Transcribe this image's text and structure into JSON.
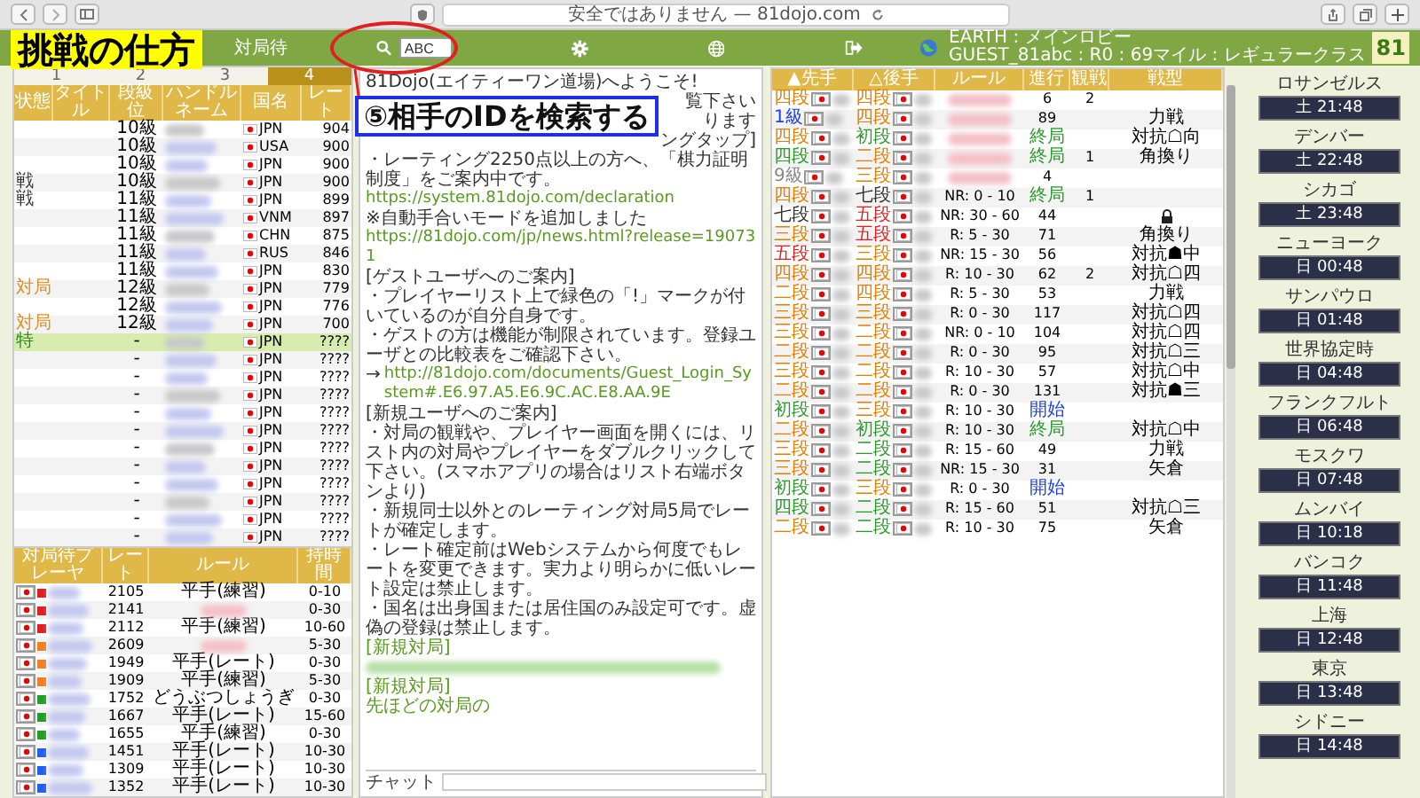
{
  "browser": {
    "address": "安全ではありません — 81dojo.com"
  },
  "overlay": {
    "label": "挑戦の仕方",
    "callout": "⑤相手のIDを検索する"
  },
  "toolbar": {
    "waiting_label": "対局待",
    "search_value": "ABC",
    "lobby_line": "EARTH : メインロビー",
    "user_line": "GUEST_81abc : R0 : 69マイル : レギュラークラス",
    "logo": "81"
  },
  "player_tabs": [
    {
      "label": "1",
      "selected": false
    },
    {
      "label": "2",
      "selected": false
    },
    {
      "label": "3",
      "selected": false
    },
    {
      "label": "4",
      "selected": true
    }
  ],
  "players": {
    "columns": [
      "状態",
      "タイトル",
      "段級位",
      "ハンドルネーム",
      "国名",
      "レート"
    ],
    "rows": [
      {
        "rank": "10級",
        "country": "JPN",
        "rate": "904",
        "selected": false
      },
      {
        "rank": "10級",
        "country": "USA",
        "rate": "900",
        "selected": false
      },
      {
        "rank": "10級",
        "country": "JPN",
        "rate": "900",
        "selected": false
      },
      {
        "status": "戦",
        "color": "#333333",
        "rank": "10級",
        "country": "JPN",
        "rate": "900",
        "selected": false
      },
      {
        "status": "戦",
        "color": "#333333",
        "rank": "11級",
        "country": "JPN",
        "rate": "899",
        "selected": false
      },
      {
        "rank": "11級",
        "country": "VNM",
        "rate": "897",
        "selected": false
      },
      {
        "rank": "11級",
        "country": "CHN",
        "rate": "875",
        "selected": false
      },
      {
        "rank": "11級",
        "country": "RUS",
        "rate": "846",
        "selected": false
      },
      {
        "rank": "11級",
        "country": "JPN",
        "rate": "830",
        "selected": false
      },
      {
        "status": "対局",
        "color": "#e09020",
        "rank": "12級",
        "country": "JPN",
        "rate": "779",
        "selected": false
      },
      {
        "rank": "12級",
        "country": "JPN",
        "rate": "776",
        "selected": false
      },
      {
        "status": "対局",
        "color": "#e09020",
        "rank": "12級",
        "country": "JPN",
        "rate": "700",
        "selected": false
      },
      {
        "status": "特",
        "color": "#2a8a20",
        "rank": "-",
        "country": "JPN",
        "rate": "????",
        "selected": true
      },
      {
        "rank": "-",
        "country": "JPN",
        "rate": "????",
        "selected": false
      },
      {
        "rank": "-",
        "country": "JPN",
        "rate": "????",
        "selected": false
      },
      {
        "rank": "-",
        "country": "JPN",
        "rate": "????",
        "selected": false
      },
      {
        "rank": "-",
        "country": "JPN",
        "rate": "????",
        "selected": false
      },
      {
        "rank": "-",
        "country": "JPN",
        "rate": "????",
        "selected": false
      },
      {
        "rank": "-",
        "country": "JPN",
        "rate": "????",
        "selected": false
      },
      {
        "rank": "-",
        "country": "JPN",
        "rate": "????",
        "selected": false
      },
      {
        "rank": "-",
        "country": "JPN",
        "rate": "????",
        "selected": false
      },
      {
        "rank": "-",
        "country": "JPN",
        "rate": "????",
        "selected": false
      },
      {
        "rank": "-",
        "country": "JPN",
        "rate": "????",
        "selected": false
      },
      {
        "rank": "-",
        "country": "JPN",
        "rate": "????",
        "selected": false
      }
    ]
  },
  "waiting": {
    "columns": [
      "対局待プレーヤ",
      "レート",
      "ルール",
      "持時間"
    ],
    "rows": [
      {
        "color": "#e02020",
        "rate": "2105",
        "rule": "平手(練習)",
        "time": "0-10"
      },
      {
        "color": "#e02020",
        "rate": "2141",
        "time": "0-30"
      },
      {
        "color": "#e02020",
        "rate": "2112",
        "rule": "平手(練習)",
        "time": "10-60"
      },
      {
        "color": "#f08020",
        "rate": "2609",
        "time": "5-30"
      },
      {
        "color": "#f08020",
        "rate": "1949",
        "rule": "平手(レート)",
        "time": "0-30"
      },
      {
        "color": "#f08020",
        "rate": "1909",
        "rule": "平手(練習)",
        "time": "5-30"
      },
      {
        "color": "#20a020",
        "rate": "1752",
        "rule": "どうぶつしょうぎ",
        "time": "0-30"
      },
      {
        "color": "#20a020",
        "rate": "1667",
        "rule": "平手(レート)",
        "time": "15-60"
      },
      {
        "color": "#20a020",
        "rate": "1655",
        "rule": "平手(練習)",
        "time": "0-30"
      },
      {
        "color": "#2060f0",
        "rate": "1451",
        "rule": "平手(レート)",
        "time": "10-30"
      },
      {
        "color": "#2060f0",
        "rate": "1309",
        "rule": "平手(レート)",
        "time": "10-30"
      },
      {
        "color": "#2060f0",
        "rate": "1352",
        "rule": "平手(レート)",
        "time": "10-30"
      }
    ]
  },
  "chat": {
    "lines": [
      {
        "kind": "heading",
        "text": "81Dojo(エイティーワン道場)へようこそ!"
      },
      {
        "kind": "fragment",
        "text": "覧下さい"
      },
      {
        "kind": "fragment",
        "text": "ります"
      },
      {
        "kind": "fragment",
        "text": "ングタップ]"
      },
      {
        "kind": "text",
        "text": "・レーティング2250点以上の方へ、「棋力証明制度」をご案内中です。"
      },
      {
        "kind": "link",
        "text": "https://system.81dojo.com/declaration"
      },
      {
        "kind": "text",
        "text": "※自動手合いモードを追加しました"
      },
      {
        "kind": "link",
        "text": "https://81dojo.com/jp/news.html?release=190731"
      },
      {
        "kind": "text",
        "text": "[ゲストユーザへのご案内]"
      },
      {
        "kind": "text",
        "text": "・プレイヤーリスト上で緑色の「!」マークが付いているのが自分自身です。"
      },
      {
        "kind": "text",
        "text": "・ゲストの方は機能が制限されています。登録ユーザとの比較表をご確認下さい。"
      },
      {
        "kind": "arrow_link",
        "arrow": "→",
        "text": "http://81dojo.com/documents/Guest_Login_System#.E6.97.A5.E6.9C.AC.E8.AA.9E"
      },
      {
        "kind": "text",
        "text": "[新規ユーザへのご案内]"
      },
      {
        "kind": "text",
        "text": "・対局の観戦や、プレイヤー画面を開くには、リスト内の対局やプレイヤーをダブルクリックして下さい。(スマホアプリの場合はリスト右端ボタンより)"
      },
      {
        "kind": "text",
        "text": "・新規同士以外とのレーティング対局5局でレートが確定します。"
      },
      {
        "kind": "text",
        "text": "・レート確定前はWebシステムから何度でもレートを変更できます。実力より明らかに低いレート設定は禁止します。"
      },
      {
        "kind": "text",
        "text": "・国名は出身国または居住国のみ設定可です。虚偽の登録は禁止します。"
      },
      {
        "kind": "note",
        "text": "[新規対局]"
      },
      {
        "kind": "blur"
      },
      {
        "kind": "note",
        "text": "[新規対局]"
      },
      {
        "kind": "note",
        "text": "先ほどの対局の"
      }
    ],
    "input_label": "チャット"
  },
  "games": {
    "columns": [
      "▲先手",
      "△後手",
      "ルール",
      "進行",
      "観戦",
      "戦型"
    ],
    "rows": [
      {
        "black": {
          "rank": "四段",
          "color": "#e08000"
        },
        "white": {
          "rank": "四段",
          "color": "#e08000"
        },
        "moves": {
          "text": "6"
        },
        "watchers": "2"
      },
      {
        "black": {
          "rank": "1級",
          "color": "#2040e0"
        },
        "white": {
          "rank": "四段",
          "color": "#e08000"
        },
        "moves": {
          "text": "89"
        },
        "opening": "力戦"
      },
      {
        "black": {
          "rank": "四段",
          "color": "#e08000"
        },
        "white": {
          "rank": "初段",
          "color": "#2a9a2a"
        },
        "moves": {
          "text": "終局",
          "color": "#2a9a2a"
        },
        "opening": "対抗☖向"
      },
      {
        "black": {
          "rank": "四段",
          "color": "#2a9a2a"
        },
        "white": {
          "rank": "二段",
          "color": "#e08000"
        },
        "moves": {
          "text": "終局",
          "color": "#2a9a2a"
        },
        "watchers": "1",
        "opening": "角換り"
      },
      {
        "black": {
          "rank": "9級",
          "color": "#888888"
        },
        "white": {
          "rank": "三段",
          "color": "#e08000"
        },
        "moves": {
          "text": "4"
        }
      },
      {
        "black": {
          "rank": "四段",
          "color": "#e08000"
        },
        "white": {
          "rank": "七段",
          "color": "#333333"
        },
        "rule": "NR: 0 - 10",
        "moves": {
          "text": "終局",
          "color": "#2a9a2a"
        },
        "watchers": "1"
      },
      {
        "black": {
          "rank": "七段",
          "color": "#333333"
        },
        "white": {
          "rank": "五段",
          "color": "#e02020"
        },
        "rule": "NR: 30 - 60",
        "moves": {
          "text": "44"
        },
        "locked": true
      },
      {
        "black": {
          "rank": "三段",
          "color": "#e08000"
        },
        "white": {
          "rank": "五段",
          "color": "#e02020"
        },
        "rule": "R: 5 - 30",
        "moves": {
          "text": "71"
        },
        "opening": "角換り"
      },
      {
        "black": {
          "rank": "五段",
          "color": "#e02020"
        },
        "white": {
          "rank": "三段",
          "color": "#e08000"
        },
        "rule": "NR: 15 - 30",
        "moves": {
          "text": "56"
        },
        "opening": "対抗☗中"
      },
      {
        "black": {
          "rank": "四段",
          "color": "#e08000"
        },
        "white": {
          "rank": "四段",
          "color": "#e08000"
        },
        "rule": "R: 10 - 30",
        "moves": {
          "text": "62"
        },
        "watchers": "2",
        "opening": "対抗☖四"
      },
      {
        "black": {
          "rank": "二段",
          "color": "#e08000"
        },
        "white": {
          "rank": "四段",
          "color": "#e08000"
        },
        "rule": "R: 5 - 30",
        "moves": {
          "text": "53"
        },
        "opening": "力戦"
      },
      {
        "black": {
          "rank": "三段",
          "color": "#e08000"
        },
        "white": {
          "rank": "三段",
          "color": "#e08000"
        },
        "rule": "R: 0 - 30",
        "moves": {
          "text": "117"
        },
        "opening": "対抗☖四"
      },
      {
        "black": {
          "rank": "三段",
          "color": "#e08000"
        },
        "white": {
          "rank": "二段",
          "color": "#e08000"
        },
        "rule": "NR: 0 - 10",
        "moves": {
          "text": "104"
        },
        "opening": "対抗☖四"
      },
      {
        "black": {
          "rank": "二段",
          "color": "#e08000"
        },
        "white": {
          "rank": "二段",
          "color": "#e08000"
        },
        "rule": "R: 0 - 30",
        "moves": {
          "text": "95"
        },
        "opening": "対抗☖三"
      },
      {
        "black": {
          "rank": "三段",
          "color": "#e08000"
        },
        "white": {
          "rank": "二段",
          "color": "#e08000"
        },
        "rule": "R: 10 - 30",
        "moves": {
          "text": "57"
        },
        "opening": "対抗☖中"
      },
      {
        "black": {
          "rank": "二段",
          "color": "#e08000"
        },
        "white": {
          "rank": "二段",
          "color": "#e08000"
        },
        "rule": "R: 0 - 30",
        "moves": {
          "text": "131"
        },
        "opening": "対抗☗三"
      },
      {
        "black": {
          "rank": "初段",
          "color": "#2a9a2a"
        },
        "white": {
          "rank": "三段",
          "color": "#e08000"
        },
        "rule": "R: 10 - 30",
        "moves": {
          "text": "開始",
          "color": "#2040e0"
        }
      },
      {
        "black": {
          "rank": "二段",
          "color": "#e08000"
        },
        "white": {
          "rank": "初段",
          "color": "#2a9a2a"
        },
        "rule": "R: 10 - 30",
        "moves": {
          "text": "終局",
          "color": "#2a9a2a"
        },
        "opening": "対抗☖中"
      },
      {
        "black": {
          "rank": "三段",
          "color": "#e08000"
        },
        "white": {
          "rank": "二段",
          "color": "#2a9a2a"
        },
        "rule": "R: 15 - 60",
        "moves": {
          "text": "49"
        },
        "opening": "力戦"
      },
      {
        "black": {
          "rank": "三段",
          "color": "#e08000"
        },
        "white": {
          "rank": "二段",
          "color": "#2a9a2a"
        },
        "rule": "NR: 15 - 30",
        "moves": {
          "text": "31"
        },
        "opening": "矢倉"
      },
      {
        "black": {
          "rank": "初段",
          "color": "#2a9a2a"
        },
        "white": {
          "rank": "三段",
          "color": "#e08000"
        },
        "rule": "R: 0 - 30",
        "moves": {
          "text": "開始",
          "color": "#2040e0"
        }
      },
      {
        "black": {
          "rank": "四段",
          "color": "#2a9a2a"
        },
        "white": {
          "rank": "二段",
          "color": "#2a9a2a"
        },
        "rule": "R: 15 - 60",
        "moves": {
          "text": "51"
        },
        "opening": "対抗☖三"
      },
      {
        "black": {
          "rank": "二段",
          "color": "#e08000"
        },
        "white": {
          "rank": "二段",
          "color": "#2a9a2a"
        },
        "rule": "R: 10 - 30",
        "moves": {
          "text": "75"
        },
        "opening": "矢倉"
      }
    ]
  },
  "clocks": [
    {
      "city": "ロサンゼルス",
      "time": "土 21:48"
    },
    {
      "city": "デンバー",
      "time": "土 22:48"
    },
    {
      "city": "シカゴ",
      "time": "土 23:48"
    },
    {
      "city": "ニューヨーク",
      "time": "日 00:48"
    },
    {
      "city": "サンパウロ",
      "time": "日 01:48"
    },
    {
      "city": "世界協定時",
      "time": "日 04:48"
    },
    {
      "city": "フランクフルト",
      "time": "日 06:48"
    },
    {
      "city": "モスクワ",
      "time": "日 07:48"
    },
    {
      "city": "ムンバイ",
      "time": "日 10:18"
    },
    {
      "city": "バンコク",
      "time": "日 11:48"
    },
    {
      "city": "上海",
      "time": "日 12:48"
    },
    {
      "city": "東京",
      "time": "日 13:48"
    },
    {
      "city": "シドニー",
      "time": "日 14:48"
    }
  ]
}
